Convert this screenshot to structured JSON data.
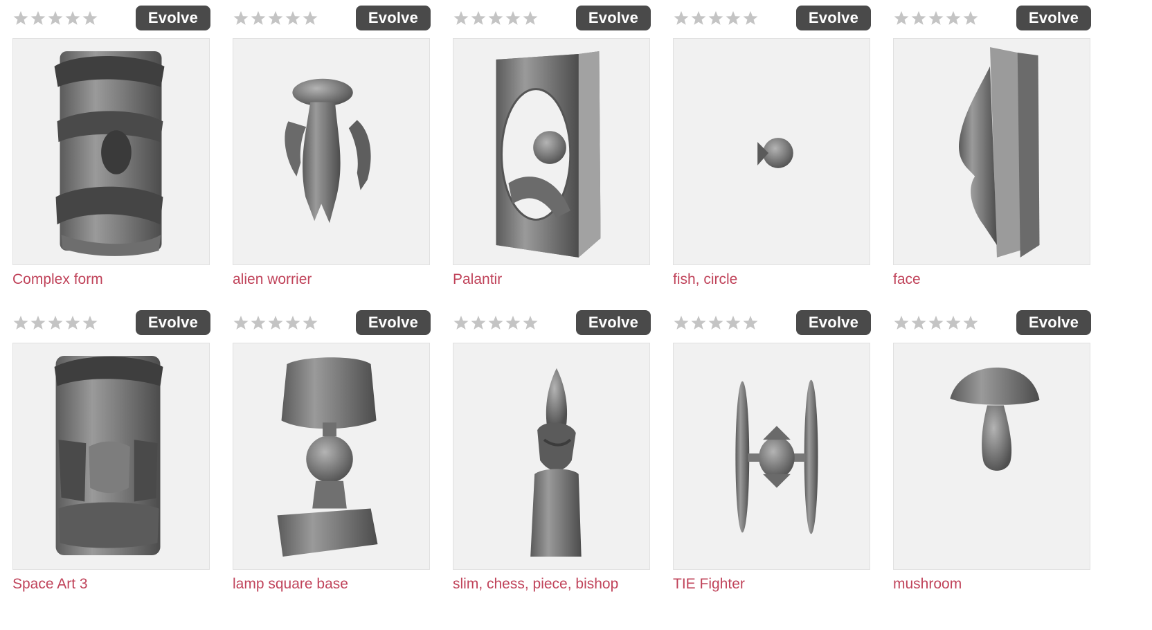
{
  "evolve_label": "Evolve",
  "colors": {
    "accent_link": "#c0435a",
    "button_bg": "#4a4a4a",
    "star_empty": "#c4c4c4",
    "thumb_bg": "#f1f1f1"
  },
  "rating_max": 5,
  "items": [
    {
      "title": "Complex form",
      "rating": 0,
      "shape": "complex-form"
    },
    {
      "title": "alien worrier",
      "rating": 0,
      "shape": "alien-worrier"
    },
    {
      "title": "Palantir",
      "rating": 0,
      "shape": "palantir"
    },
    {
      "title": "fish, circle",
      "rating": 0,
      "shape": "fish-circle"
    },
    {
      "title": "face",
      "rating": 0,
      "shape": "face"
    },
    {
      "title": "Space Art 3",
      "rating": 0,
      "shape": "space-art"
    },
    {
      "title": "lamp square base",
      "rating": 0,
      "shape": "lamp"
    },
    {
      "title": "slim, chess, piece, bishop",
      "rating": 0,
      "shape": "bishop"
    },
    {
      "title": "TIE Fighter",
      "rating": 0,
      "shape": "tie-fighter"
    },
    {
      "title": "mushroom",
      "rating": 0,
      "shape": "mushroom"
    }
  ]
}
